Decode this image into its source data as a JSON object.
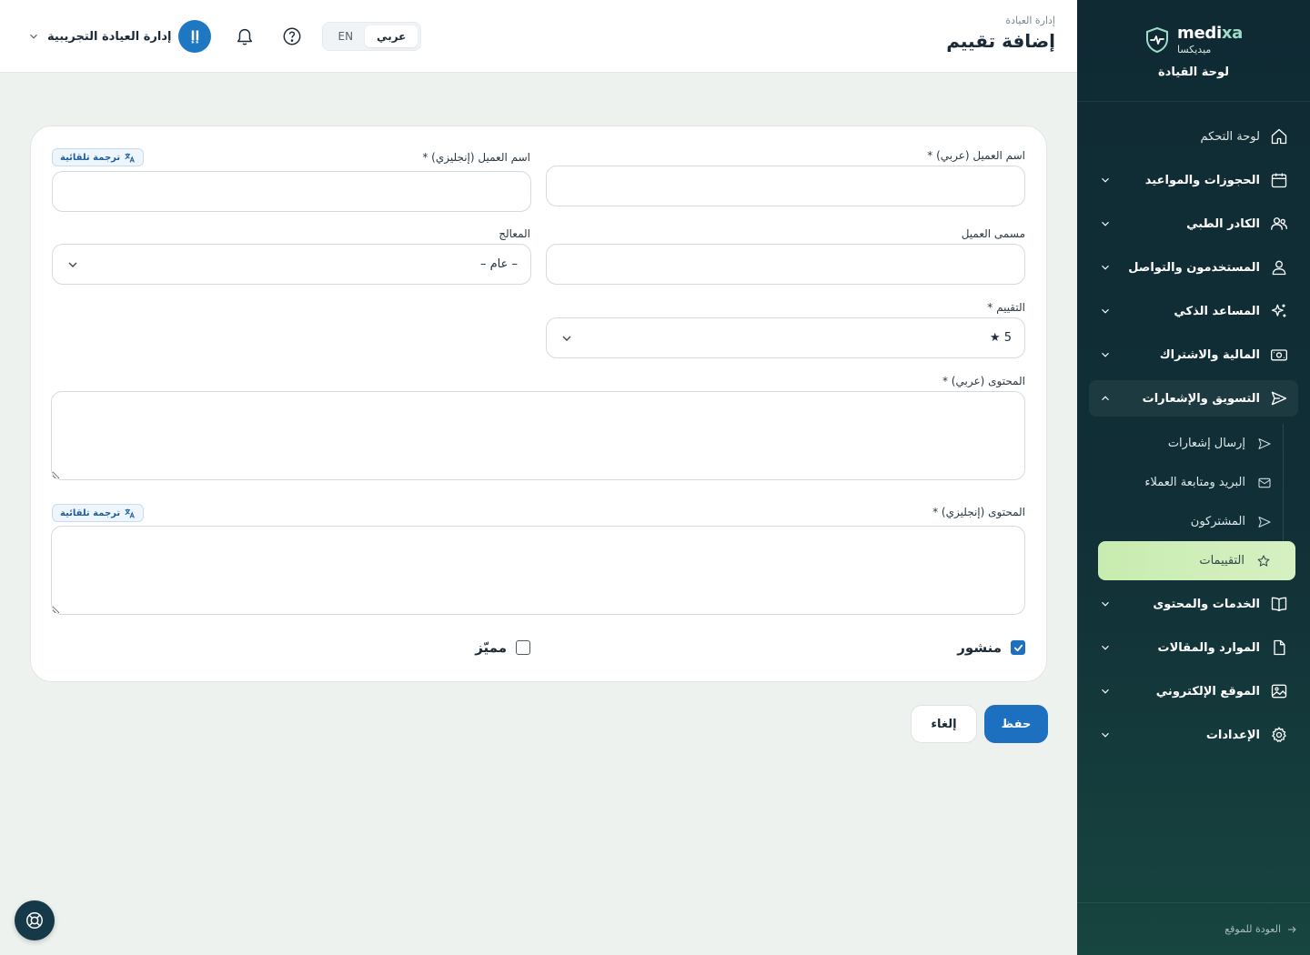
{
  "brand": {
    "name_prefix": "medi",
    "name_suffix": "xa",
    "name_ar": "ميديكسا",
    "caption": "لوحة القيادة"
  },
  "sidebar": {
    "items": [
      {
        "label": "لوحة التحكم",
        "icon": "home-icon"
      },
      {
        "label": "الحجوزات والمواعيد",
        "icon": "calendar-icon"
      },
      {
        "label": "الكادر الطبي",
        "icon": "users-icon"
      },
      {
        "label": "المستخدمون والتواصل",
        "icon": "user-icon"
      },
      {
        "label": "المساعد الذكي",
        "icon": "sparkles-icon"
      },
      {
        "label": "المالية والاشتراك",
        "icon": "banknote-icon"
      },
      {
        "label": "التسويق والإشعارات",
        "icon": "send-icon"
      },
      {
        "label": "الخدمات والمحتوى",
        "icon": "book-icon"
      },
      {
        "label": "الموارد والمقالات",
        "icon": "file-icon"
      },
      {
        "label": "الموقع الإلكتروني",
        "icon": "image-icon"
      },
      {
        "label": "الإعدادات",
        "icon": "gear-icon"
      }
    ],
    "sub_items": [
      {
        "label": "إرسال إشعارات",
        "icon": "send-icon"
      },
      {
        "label": "البريد ومتابعة العملاء",
        "icon": "mail-icon"
      },
      {
        "label": "المشتركون",
        "icon": "send-icon"
      },
      {
        "label": "التقييمات",
        "icon": "star-icon"
      }
    ],
    "back_link": "العودة للموقع"
  },
  "header": {
    "breadcrumb": "إدارة العيادة",
    "title": "إضافة تقييم",
    "user_name": "إدارة العيادة التجريبية",
    "avatar_initials": "إإ",
    "lang_ar": "عربي",
    "lang_en": "EN"
  },
  "form": {
    "client_name_ar_label": "اسم العميل (عربي) *",
    "client_name_en_label": "اسم العميل (إنجليزي) *",
    "auto_translate": "ترجمة تلقائية",
    "client_title_label": "مسمى العميل",
    "therapist_label": "المعالج",
    "therapist_value": "– عام –",
    "rating_label": "التقييم *",
    "rating_value": "5 ★",
    "content_ar_label": "المحتوى (عربي) *",
    "content_en_label": "المحتوى (إنجليزي) *",
    "published_label": "منشور",
    "featured_label": "مميّز",
    "published_checked": true,
    "featured_checked": false
  },
  "actions": {
    "save": "حفظ",
    "cancel": "إلغاء"
  },
  "colors": {
    "primary": "#1d6fc0",
    "sidebar_bg": "#0f2a33",
    "active_item_bg": "#c8ecb0"
  }
}
